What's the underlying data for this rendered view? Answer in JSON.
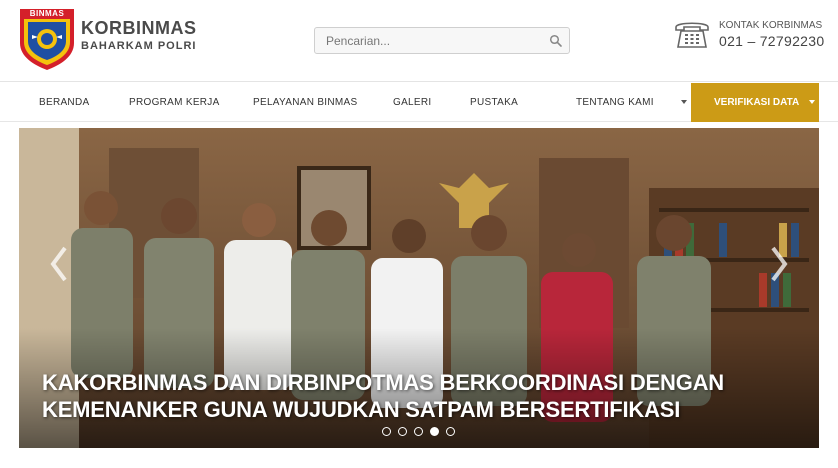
{
  "brand": {
    "logo_text": "BINMAS",
    "title": "KORBINMAS",
    "subtitle": "BAHARKAM POLRI"
  },
  "search": {
    "placeholder": "Pencarian...",
    "icon": "search-icon"
  },
  "contact": {
    "icon": "telephone-icon",
    "label": "KONTAK KORBINMAS",
    "phone": "021 – 72792230"
  },
  "nav": {
    "items": [
      {
        "label": "BERANDA"
      },
      {
        "label": "PROGRAM KERJA"
      },
      {
        "label": "PELAYANAN BINMAS"
      },
      {
        "label": "GALERI"
      },
      {
        "label": "PUSTAKA"
      },
      {
        "label": "TENTANG KAMI"
      }
    ],
    "cta_label": "VERIFIKASI DATA",
    "accent_color": "#cc9b16"
  },
  "slider": {
    "caption_line1": "KAKORBINMAS DAN DIRBINPOTMAS BERKOORDINASI DENGAN",
    "caption_line2": "KEMENANKER GUNA WUJUDKAN SATPAM BERSERTIFIKASI",
    "slide_count": 5,
    "active_slide": 4
  }
}
